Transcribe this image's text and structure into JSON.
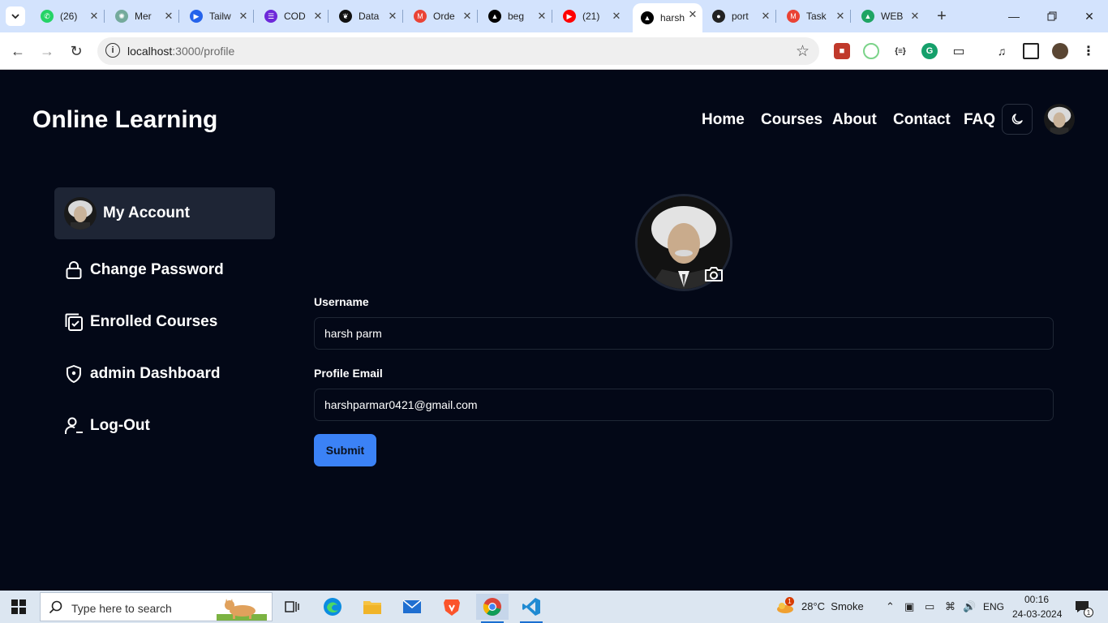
{
  "browser": {
    "tabs": [
      {
        "title": "(26)",
        "icon": "whatsapp-icon",
        "color": "#25d366",
        "glyph": "✆"
      },
      {
        "title": "Mer",
        "icon": "chatgpt-icon",
        "color": "#74aa9c",
        "glyph": "✺"
      },
      {
        "title": "Tailw",
        "icon": "tailwind-play-icon",
        "color": "#2563eb",
        "glyph": "▶"
      },
      {
        "title": "COD",
        "icon": "list-icon",
        "color": "#6d28d9",
        "glyph": "☰"
      },
      {
        "title": "Data",
        "icon": "mongodb-leaf-icon",
        "color": "#111111",
        "glyph": "❦"
      },
      {
        "title": "Orde",
        "icon": "gmail-icon",
        "color": "#ea4335",
        "glyph": "M"
      },
      {
        "title": "beg",
        "icon": "vercel-triangle-icon",
        "color": "#000000",
        "glyph": "▲"
      },
      {
        "title": "(21)",
        "icon": "youtube-icon",
        "color": "#ff0000",
        "glyph": "▶"
      },
      {
        "title": "harsh",
        "icon": "vercel-triangle-icon",
        "color": "#000000",
        "glyph": "▲"
      },
      {
        "title": "port",
        "icon": "github-icon",
        "color": "#222222",
        "glyph": "●"
      },
      {
        "title": "Task",
        "icon": "gmail-icon",
        "color": "#ea4335",
        "glyph": "M"
      },
      {
        "title": "WEB",
        "icon": "google-drive-icon",
        "color": "#1fa463",
        "glyph": "▲"
      }
    ],
    "url_host": "localhost",
    "url_path": ":3000/profile"
  },
  "site": {
    "brand": "Online Learning",
    "nav": [
      "Home",
      "Courses",
      "About",
      "Contact",
      "FAQ"
    ]
  },
  "sidebar": {
    "items": [
      {
        "label": "My Account",
        "icon": "avatar"
      },
      {
        "label": "Change Password",
        "icon": "lock-icon"
      },
      {
        "label": "Enrolled Courses",
        "icon": "checklist-icon"
      },
      {
        "label": "admin Dashboard",
        "icon": "shield-icon"
      },
      {
        "label": "Log-Out",
        "icon": "user-logout-icon"
      }
    ]
  },
  "profile": {
    "username_label": "Username",
    "username_value": "harsh parm",
    "email_label": "Profile Email",
    "email_value": "harshparmar0421@gmail.com",
    "submit_label": "Submit"
  },
  "taskbar": {
    "search_placeholder": "Type here to search",
    "weather_badge": "1",
    "weather": "28°C  Smoke",
    "language": "ENG",
    "time": "00:16",
    "date": "24-03-2024",
    "notification_count": "1"
  },
  "colors": {
    "page_bg": "#030817",
    "accent": "#3b82f6",
    "active_item_bg": "#1e2535"
  }
}
